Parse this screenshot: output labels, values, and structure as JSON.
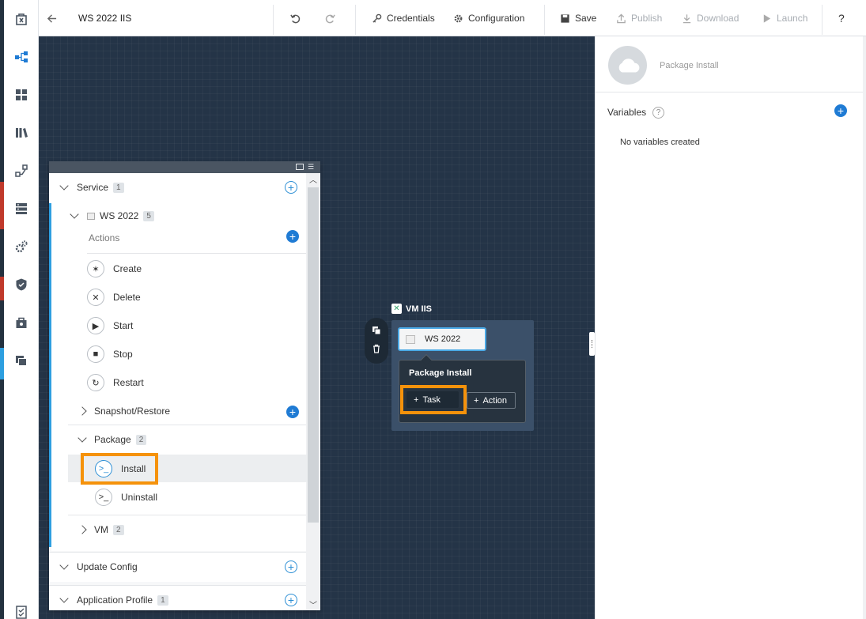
{
  "topbar": {
    "title": "WS 2022 IIS",
    "credentials_label": "Credentials",
    "configuration_label": "Configuration",
    "save_label": "Save",
    "publish_label": "Publish",
    "download_label": "Download",
    "launch_label": "Launch",
    "help_label": "?"
  },
  "rail": {
    "icons": [
      "marketplace-icon",
      "blueprints-icon",
      "applications-icon",
      "library-icon",
      "runbooks-icon",
      "endpoints-icon",
      "settings-icon",
      "policies-icon",
      "projects-icon",
      "environments-icon",
      "tasks-icon"
    ]
  },
  "tree": {
    "service": {
      "label": "Service",
      "count": "1"
    },
    "ws2022": {
      "label": "WS 2022",
      "count": "5"
    },
    "actions_label": "Actions",
    "actions": [
      {
        "label": "Create",
        "icon": "create-icon"
      },
      {
        "label": "Delete",
        "icon": "delete-icon"
      },
      {
        "label": "Start",
        "icon": "start-icon"
      },
      {
        "label": "Stop",
        "icon": "stop-icon"
      },
      {
        "label": "Restart",
        "icon": "restart-icon"
      }
    ],
    "snapshot_label": "Snapshot/Restore",
    "package": {
      "label": "Package",
      "count": "2"
    },
    "package_items": [
      "Install",
      "Uninstall"
    ],
    "vm": {
      "label": "VM",
      "count": "2"
    },
    "update_config_label": "Update Config",
    "app_profile": {
      "label": "Application Profile",
      "count": "1"
    }
  },
  "canvas": {
    "vm_label": "VM IIS",
    "service_chip": "WS 2022",
    "popup_title": "Package Install",
    "task_button": "Task",
    "action_button": "Action"
  },
  "rpanel": {
    "title": "Package Install",
    "variables_label": "Variables",
    "help_badge": "?",
    "empty_text": "No variables created"
  },
  "colors": {
    "canvas_bg": "#243447",
    "accent": "#1f7bd4",
    "highlight": "#f5920b",
    "tree_active_bar": "#2d9fe0"
  }
}
